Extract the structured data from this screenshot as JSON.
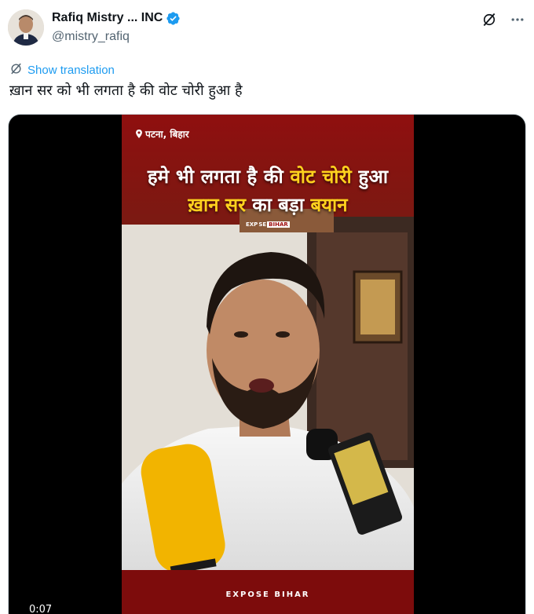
{
  "author": {
    "display_name": "Rafiq Mistry ... INC",
    "handle": "@mistry_rafiq",
    "verified": true
  },
  "actions": {
    "grok_icon": "grok-icon",
    "more_icon": "more-icon"
  },
  "translation": {
    "label": "Show translation"
  },
  "tweet": {
    "text": "ख़ान सर को भी लगता है की वोट चोरी हुआ है"
  },
  "video": {
    "location": "पटना, बिहार",
    "headline_line1_a": "हमे भी लगता है की ",
    "headline_line1_b": "वोट चोरी",
    "headline_line1_c": " हुआ",
    "headline_line2_a": "ख़ान सर",
    "headline_line2_b": " का बड़ा ",
    "headline_line2_c": "बयान",
    "brand_small_a": "EXP",
    "brand_small_b": "SE",
    "brand_small_c": "BIHAR",
    "footer": "EXPOSE BIHAR",
    "timestamp": "0:07"
  },
  "colors": {
    "accent": "#1d9bf0",
    "verified": "#1d9bf0",
    "video_bg": "#8f0f0f",
    "highlight": "#ffd21e"
  }
}
